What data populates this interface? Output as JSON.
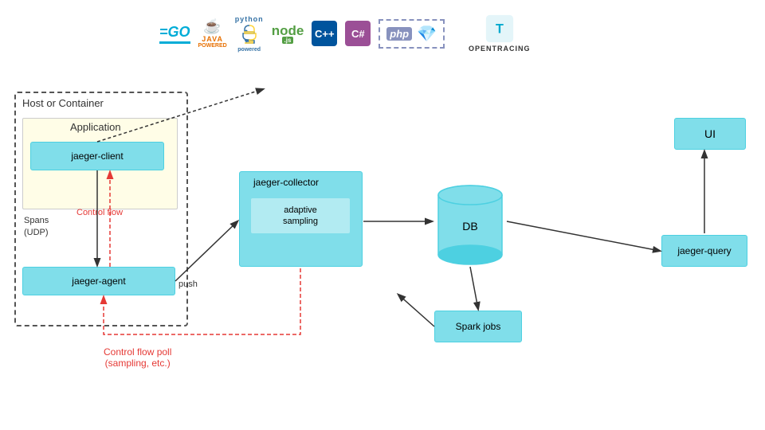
{
  "logos": {
    "go": "=GO",
    "java": "Java",
    "python": "python",
    "node": "node",
    "cpp": "C++",
    "csharp": "C#",
    "php": "php",
    "ruby": "◆",
    "opentracing": "OPENTRACING"
  },
  "diagram": {
    "host_label": "Host or Container",
    "application_label": "Application",
    "jaeger_client": "jaeger-client",
    "jaeger_agent": "jaeger-agent",
    "jaeger_collector": "jaeger-collector",
    "adaptive_sampling": "adaptive\nsampling",
    "db": "DB",
    "spark_jobs": "Spark jobs",
    "ui": "UI",
    "jaeger_query": "jaeger-query",
    "spans_label": "Spans\n(UDP)",
    "control_flow_label": "Control flow",
    "push_label": "push",
    "control_flow_poll_label": "Control flow poll\n(sampling, etc.)"
  }
}
